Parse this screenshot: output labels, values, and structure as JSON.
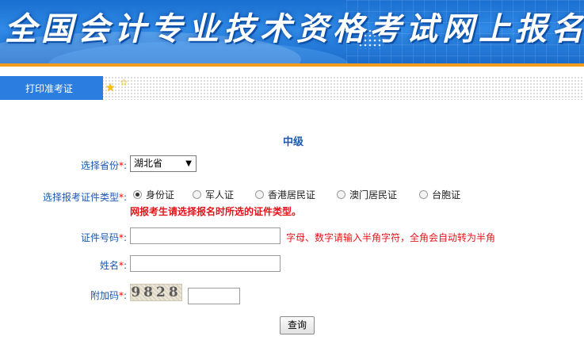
{
  "header": {
    "title": "全国会计专业技术资格考试网上报名系统"
  },
  "nav": {
    "tab_label": "打印准考证"
  },
  "form": {
    "section_title": "中级",
    "province": {
      "label": "选择省份",
      "required_mark": "*",
      "colon": ":",
      "selected": "湖北省"
    },
    "id_type": {
      "label": "选择报考证件类型",
      "required_mark": "*",
      "colon": ":",
      "options": [
        "身份证",
        "军人证",
        "香港居民证",
        "澳门居民证",
        "台胞证"
      ],
      "selected_index": 0,
      "warning": "网报考生请选择报名时所选的证件类型。"
    },
    "id_number": {
      "label": "证件号码",
      "required_mark": "*",
      "colon": ":",
      "value": "",
      "hint": "字母、数字请输入半角字符，全角会自动转为半角"
    },
    "name": {
      "label": "姓名",
      "required_mark": "*",
      "colon": ":",
      "value": ""
    },
    "captcha": {
      "label": "附加码",
      "required_mark": "*",
      "colon": ":",
      "image_text": "9828",
      "value": ""
    },
    "submit_label": "查询"
  },
  "colors": {
    "banner_blue": "#2f8ae6",
    "accent_orange": "#f29b1d",
    "label_blue": "#1b57b3",
    "warning_red": "#e4141b"
  }
}
